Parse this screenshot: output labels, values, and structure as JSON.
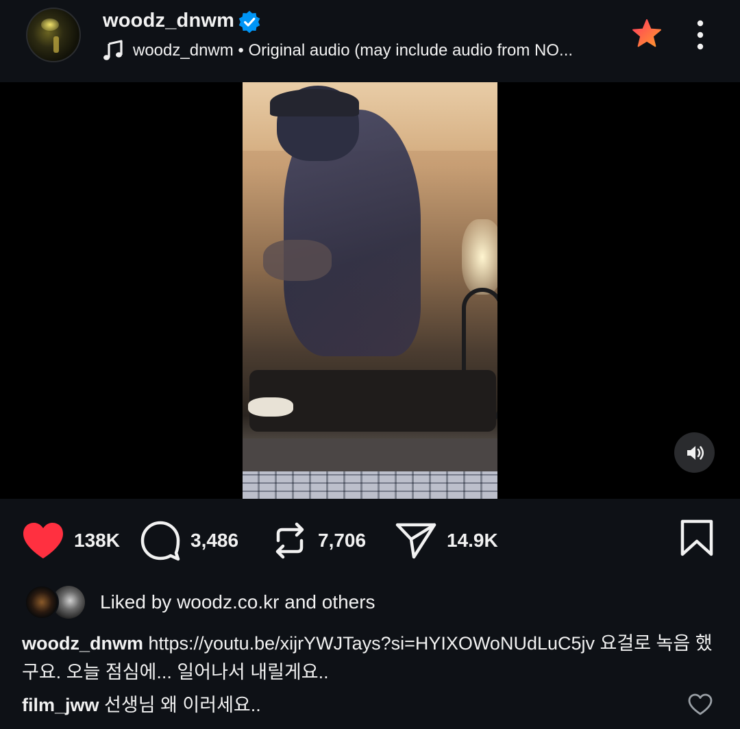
{
  "header": {
    "username": "woodz_dnwm",
    "verified": true,
    "audio_label": "woodz_dnwm • Original audio (may include audio from NO..."
  },
  "icons": {
    "verified": "verified-badge-icon",
    "music": "music-note-icon",
    "favorite": "star-icon",
    "more": "more-vertical-icon",
    "volume": "volume-icon",
    "like": "heart-icon",
    "comment": "comment-icon",
    "repost": "repost-icon",
    "share": "send-icon",
    "save": "bookmark-icon",
    "comment_like": "heart-outline-icon"
  },
  "colors": {
    "background": "#0e1116",
    "like_red": "#ff3040",
    "verified_blue": "#0095f6",
    "star_gradient": [
      "#ff3b5c",
      "#ff9a2e"
    ]
  },
  "actions": {
    "likes": "138K",
    "comments": "3,486",
    "reposts": "7,706",
    "shares": "14.9K"
  },
  "liked_by": {
    "text": "Liked by woodz.co.kr and others"
  },
  "caption": {
    "username": "woodz_dnwm",
    "text": "https://youtu.be/xijrYWJTays?si=HYIXOWoNUdLuC5jv 요걸로 녹음 했구요. 오늘 점심에... 일어나서 내릴게요.."
  },
  "comment": {
    "username": "film_jww",
    "text": "선생님 왜 이러세요.."
  }
}
